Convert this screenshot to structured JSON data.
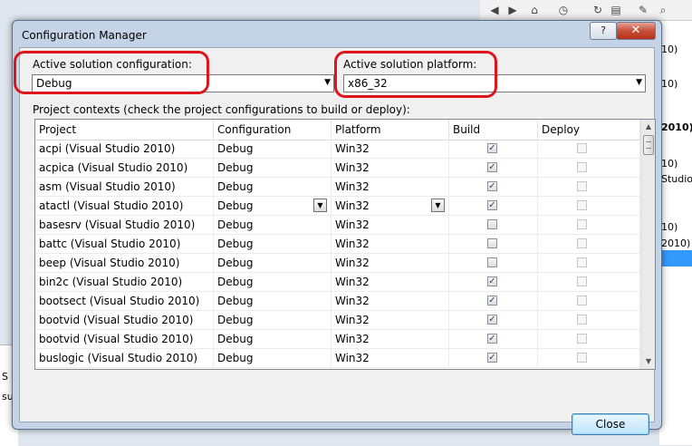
{
  "dialog": {
    "title": "Configuration Manager",
    "help_label": "?",
    "close_glyph": "✕"
  },
  "config": {
    "label": "Active solution configuration:",
    "value": "Debug"
  },
  "platform": {
    "label": "Active solution platform:",
    "value": "x86_32"
  },
  "contexts_label": "Project contexts (check the project configurations to build or deploy):",
  "columns": [
    "Project",
    "Configuration",
    "Platform",
    "Build",
    "Deploy"
  ],
  "rows": [
    {
      "project": "acpi (Visual Studio 2010)",
      "configuration": "Debug",
      "platform": "Win32",
      "build": true,
      "deploy": false
    },
    {
      "project": "acpica (Visual Studio 2010)",
      "configuration": "Debug",
      "platform": "Win32",
      "build": true,
      "deploy": false
    },
    {
      "project": "asm (Visual Studio 2010)",
      "configuration": "Debug",
      "platform": "Win32",
      "build": true,
      "deploy": false
    },
    {
      "project": "atactl (Visual Studio 2010)",
      "configuration": "Debug",
      "platform": "Win32",
      "build": true,
      "deploy": false
    },
    {
      "project": "basesrv (Visual Studio 2010)",
      "configuration": "Debug",
      "platform": "Win32",
      "build": false,
      "deploy": false
    },
    {
      "project": "battc (Visual Studio 2010)",
      "configuration": "Debug",
      "platform": "Win32",
      "build": false,
      "deploy": false
    },
    {
      "project": "beep (Visual Studio 2010)",
      "configuration": "Debug",
      "platform": "Win32",
      "build": false,
      "deploy": false
    },
    {
      "project": "bin2c (Visual Studio 2010)",
      "configuration": "Debug",
      "platform": "Win32",
      "build": true,
      "deploy": false
    },
    {
      "project": "bootsect (Visual Studio 2010)",
      "configuration": "Debug",
      "platform": "Win32",
      "build": true,
      "deploy": false
    },
    {
      "project": "bootvid (Visual Studio 2010)",
      "configuration": "Debug",
      "platform": "Win32",
      "build": true,
      "deploy": false
    },
    {
      "project": "bootvid (Visual Studio 2010)",
      "configuration": "Debug",
      "platform": "Win32",
      "build": true,
      "deploy": false
    },
    {
      "project": "buslogic (Visual Studio 2010)",
      "configuration": "Debug",
      "platform": "Win32",
      "build": true,
      "deploy": false
    }
  ],
  "close_button": "Close",
  "background": {
    "fragments": [
      "10)",
      "10)",
      "2010)",
      "10)",
      "Studio",
      "10)",
      "2010)"
    ],
    "left_fragments": [
      "S",
      "sua"
    ]
  },
  "icons": {
    "checked": "✓",
    "dropdown": "▼",
    "scroll_up": "▲",
    "scroll_down": "▼"
  }
}
